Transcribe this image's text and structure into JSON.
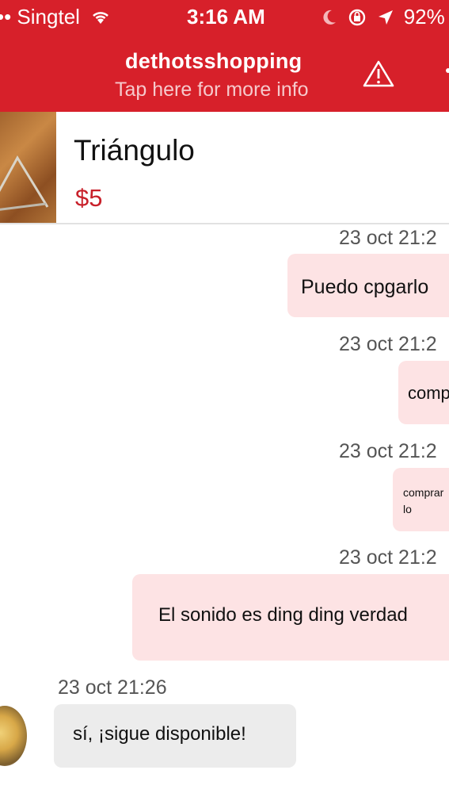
{
  "status_bar": {
    "carrier": "•• Singtel",
    "time": "3:16 AM",
    "battery": "92%"
  },
  "header": {
    "title": "dethotsshopping",
    "subtitle": "Tap here for more info"
  },
  "product": {
    "name": "Triángulo",
    "price": "$5"
  },
  "messages": [
    {
      "timestamp": "23 oct 21:2",
      "text": "Puedo cpgarlo",
      "direction": "outgoing"
    },
    {
      "timestamp": "23 oct 21:2",
      "text": "comp",
      "direction": "outgoing"
    },
    {
      "timestamp": "23 oct 21:2",
      "text": "comprar",
      "text2": "lo",
      "direction": "outgoing"
    },
    {
      "timestamp": "23 oct 21:2",
      "text": "El sonido es ding ding verdad",
      "direction": "outgoing"
    },
    {
      "timestamp": "23 oct 21:26",
      "text": "sí, ¡sigue disponible!",
      "direction": "incoming"
    }
  ],
  "colors": {
    "brand": "#d7202a",
    "outgoing_bubble": "#fde3e4",
    "incoming_bubble": "#ececec"
  }
}
